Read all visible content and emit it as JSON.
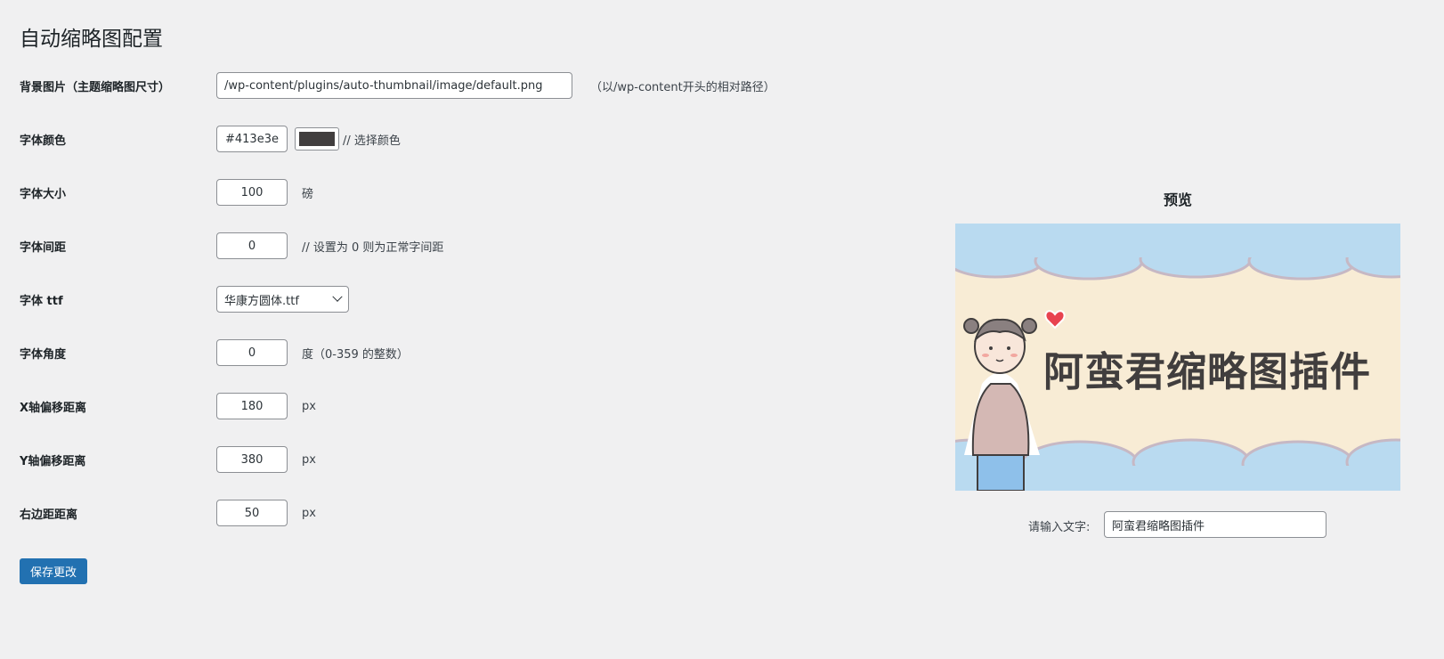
{
  "page": {
    "title": "自动缩略图配置"
  },
  "fields": {
    "bg_image": {
      "label": "背景图片（主题缩略图尺寸）",
      "value": "/wp-content/plugins/auto-thumbnail/image/default.png",
      "hint": "（以/wp-content开头的相对路径）"
    },
    "font_color": {
      "label": "字体颜色",
      "value": "#413e3e",
      "hint": "// 选择颜色",
      "swatch": "#413e3e"
    },
    "font_size": {
      "label": "字体大小",
      "value": "100",
      "hint": "磅"
    },
    "font_spacing": {
      "label": "字体间距",
      "value": "0",
      "hint": "// 设置为 0 则为正常字间距"
    },
    "font_ttf": {
      "label": "字体 ttf",
      "value": "华康方圆体.ttf"
    },
    "font_angle": {
      "label": "字体角度",
      "value": "0",
      "hint": "度（0-359 的整数）"
    },
    "x_offset": {
      "label": "X轴偏移距离",
      "value": "180",
      "hint": "px"
    },
    "y_offset": {
      "label": "Y轴偏移距离",
      "value": "380",
      "hint": "px"
    },
    "right_margin": {
      "label": "右边距距离",
      "value": "50",
      "hint": "px"
    }
  },
  "save_label": "保存更改",
  "preview": {
    "title": "预览",
    "image_text": "阿蛮君缩略图插件",
    "input_label": "请输入文字:",
    "input_value": "阿蛮君缩略图插件"
  },
  "colors": {
    "accent": "#2271b1",
    "sky": "#b9daf0",
    "cream": "#f8ecd5",
    "shirt": "#d4b8b4",
    "jeans": "#8ec0ea",
    "heart": "#e8434f"
  }
}
